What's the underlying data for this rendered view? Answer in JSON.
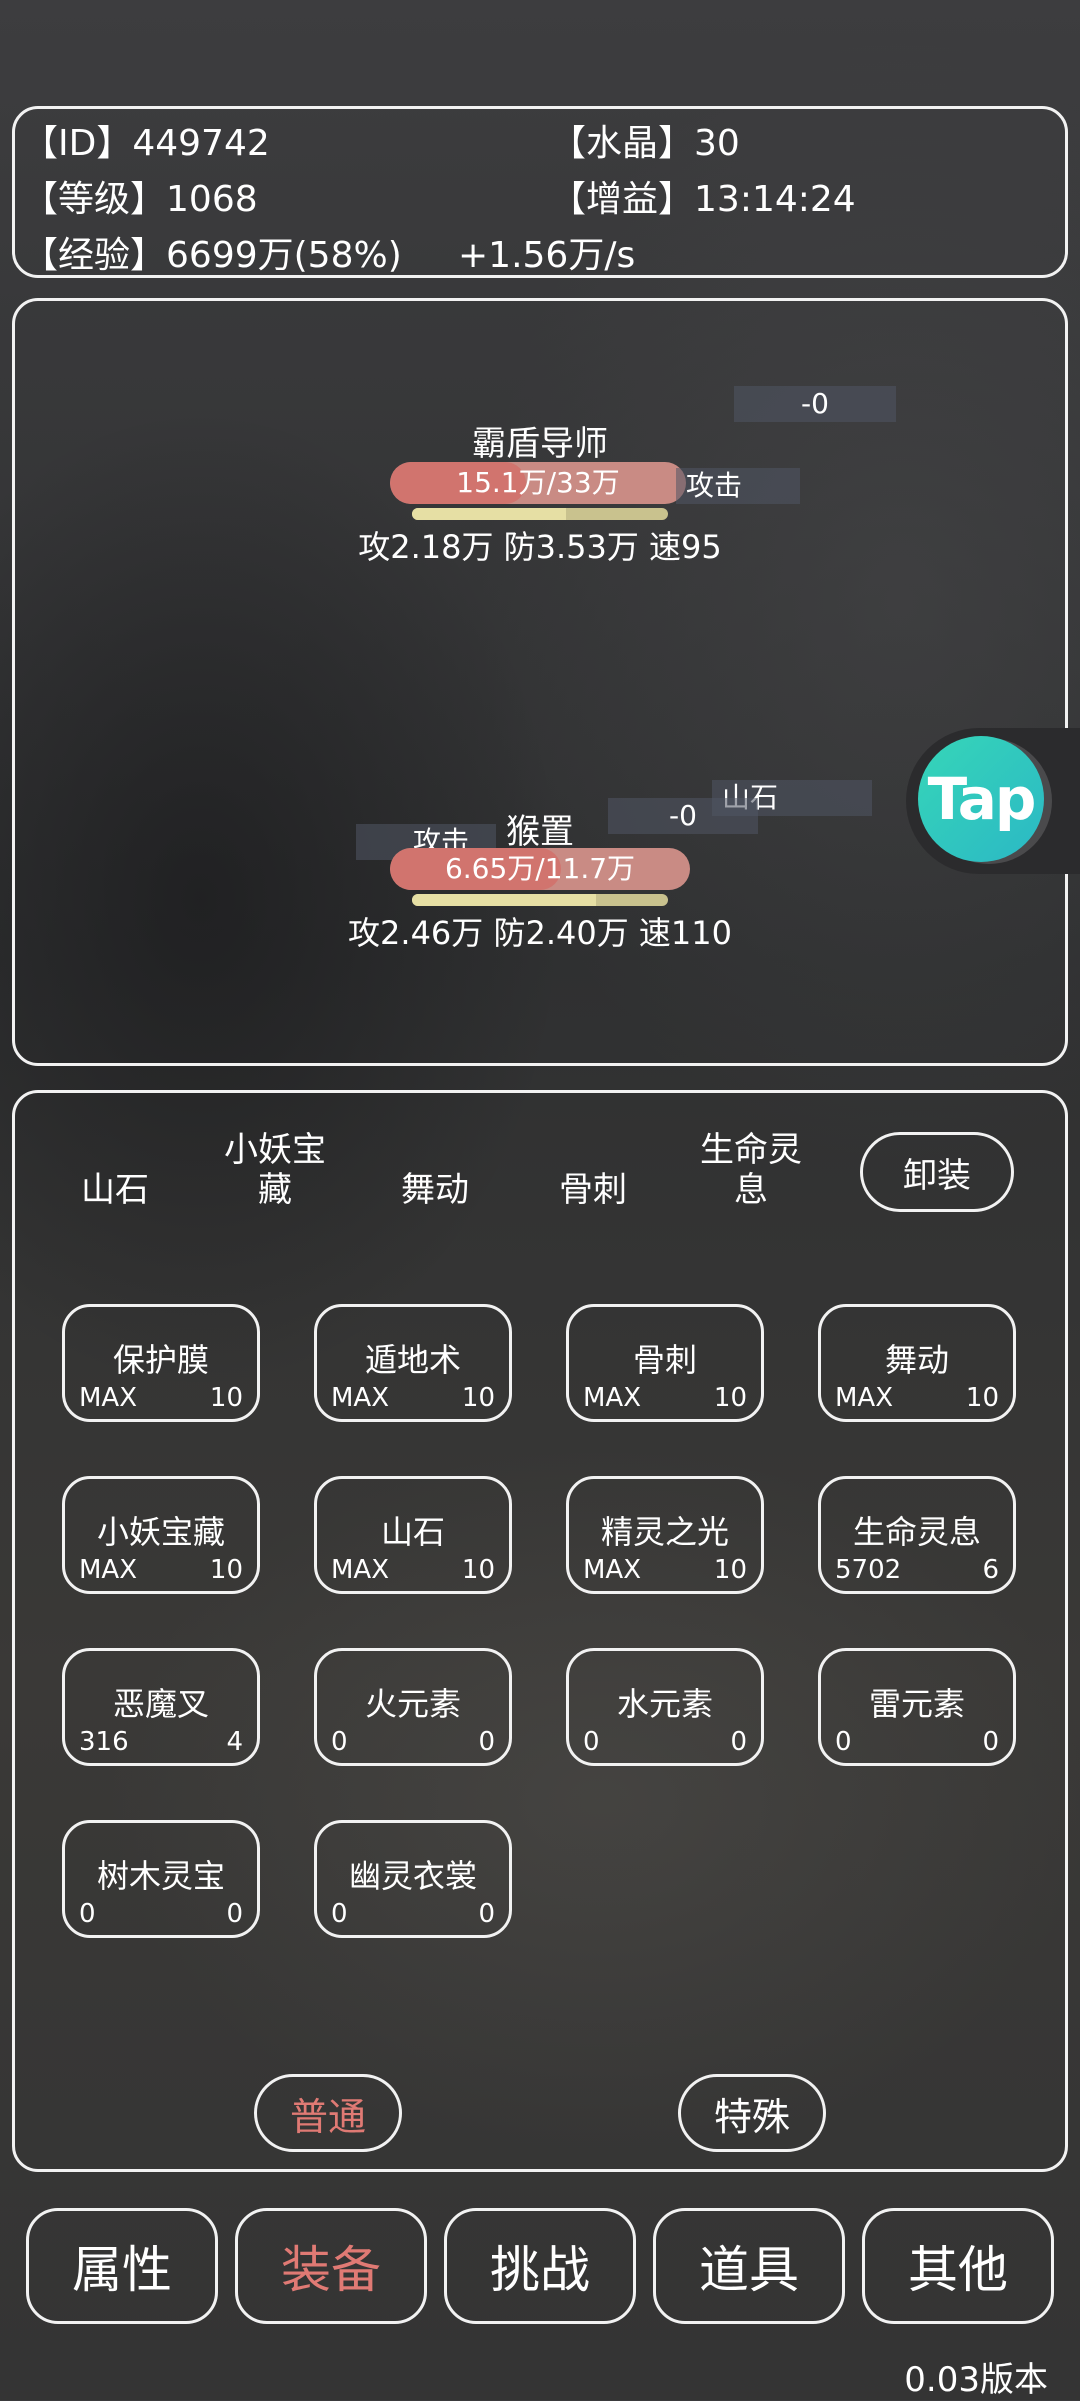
{
  "info": {
    "id_label": "【ID】",
    "id_value": "449742",
    "crystal_label": "【水晶】",
    "crystal_value": "30",
    "level_label": "【等级】",
    "level_value": "1068",
    "buff_label": "【增益】",
    "buff_value": "13:14:24",
    "exp_label": "【经验】",
    "exp_value": "6699万(58%)",
    "exp_rate": "+1.56万/s"
  },
  "battle": {
    "enemy": {
      "name": "霸盾导师",
      "hp_text": "15.1万/33万",
      "hp_fraction": 0.46,
      "mp_fraction": 0.6,
      "stats": "攻2.18万  防3.53万  速95",
      "float_damage": "-0",
      "float_action": "攻击"
    },
    "player": {
      "name": "猴置",
      "hp_text": "6.65万/11.7万",
      "hp_fraction": 0.57,
      "mp_fraction": 0.72,
      "stats": "攻2.46万  防2.40万  速110",
      "float_action_left": "攻击",
      "float_damage": "-0",
      "float_skill": "山石"
    }
  },
  "tap_badge": "Tap",
  "equipped": {
    "slots": [
      "山石",
      "小妖宝\n藏",
      "舞动",
      "骨刺",
      "生命灵\n息"
    ],
    "unequip_label": "卸装"
  },
  "skills": [
    {
      "name": "保护膜",
      "level": "MAX",
      "count": "10"
    },
    {
      "name": "遁地术",
      "level": "MAX",
      "count": "10"
    },
    {
      "name": "骨刺",
      "level": "MAX",
      "count": "10"
    },
    {
      "name": "舞动",
      "level": "MAX",
      "count": "10"
    },
    {
      "name": "小妖宝藏",
      "level": "MAX",
      "count": "10"
    },
    {
      "name": "山石",
      "level": "MAX",
      "count": "10"
    },
    {
      "name": "精灵之光",
      "level": "MAX",
      "count": "10"
    },
    {
      "name": "生命灵息",
      "level": "5702",
      "count": "6"
    },
    {
      "name": "恶魔叉",
      "level": "316",
      "count": "4"
    },
    {
      "name": "火元素",
      "level": "0",
      "count": "0"
    },
    {
      "name": "水元素",
      "level": "0",
      "count": "0"
    },
    {
      "name": "雷元素",
      "level": "0",
      "count": "0"
    },
    {
      "name": "树木灵宝",
      "level": "0",
      "count": "0"
    },
    {
      "name": "幽灵衣裳",
      "level": "0",
      "count": "0"
    }
  ],
  "filter": {
    "normal_label": "普通",
    "special_label": "特殊",
    "active": "normal",
    "active_color": "#e07a74"
  },
  "nav": {
    "tabs": [
      "属性",
      "装备",
      "挑战",
      "道具",
      "其他"
    ],
    "active_index": 1,
    "active_color": "#e07a74"
  },
  "version": "0.03版本"
}
